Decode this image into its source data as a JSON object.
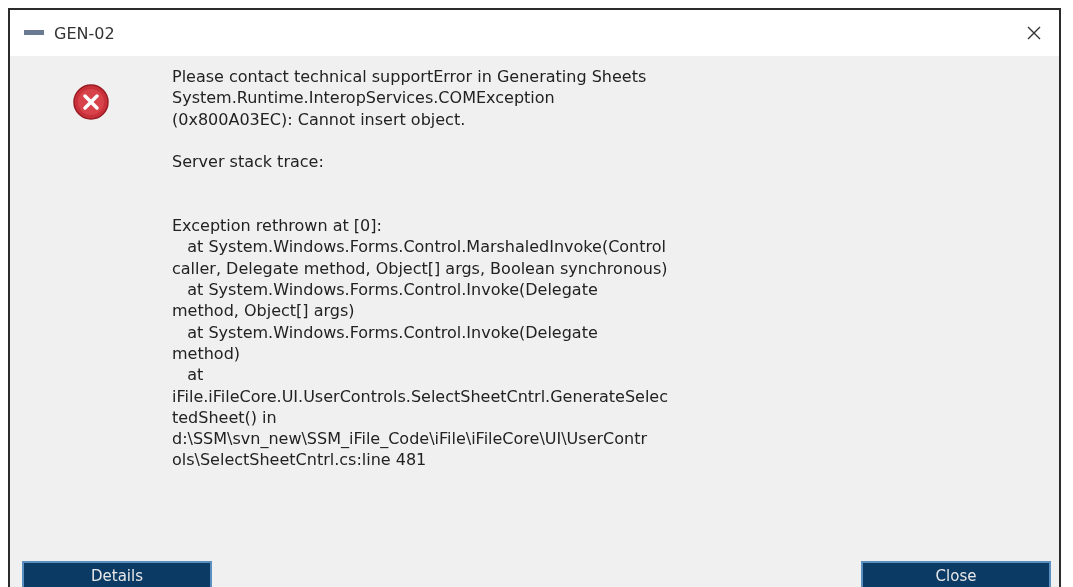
{
  "window": {
    "title": "GEN-02"
  },
  "message": [
    [
      "Please contact technical supportError in Generating Sheets",
      "System.Runtime.InteropServices.COMException",
      "(0x800A03EC): Cannot insert object."
    ],
    [
      "Server stack trace:"
    ],
    [
      "Exception rethrown at [0]:",
      "   at System.Windows.Forms.Control.MarshaledInvoke(Control",
      "caller, Delegate method, Object[] args, Boolean synchronous)",
      "   at System.Windows.Forms.Control.Invoke(Delegate",
      "method, Object[] args)",
      "   at System.Windows.Forms.Control.Invoke(Delegate",
      "method)",
      "   at",
      "iFile.iFileCore.UI.UserControls.SelectSheetCntrl.GenerateSelec",
      "tedSheet() in",
      "d:\\SSM\\svn_new\\SSM_iFile_Code\\iFile\\iFileCore\\UI\\UserContr",
      "ols\\SelectSheetCntrl.cs:line 481"
    ]
  ],
  "buttons": [
    "Details",
    "Close"
  ]
}
